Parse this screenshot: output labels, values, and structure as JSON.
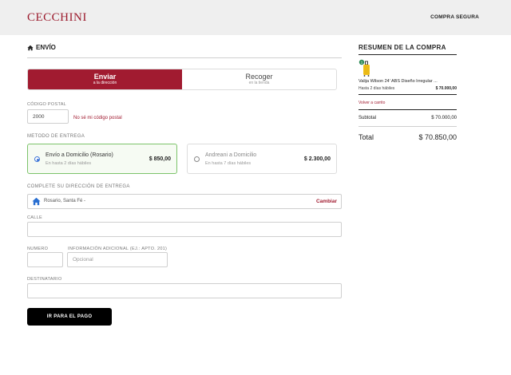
{
  "header": {
    "brand": "CECCHINI",
    "secure_label": "COMPRA SEGURA"
  },
  "shipping": {
    "section_title": "ENVÍO",
    "tabs": [
      {
        "label": "Enviar",
        "sublabel": "a la dirección",
        "active": true
      },
      {
        "label": "Recoger",
        "sublabel": "en la tienda",
        "active": false
      }
    ],
    "postal_code_label": "CÓDIGO POSTAL",
    "postal_code_value": "2000",
    "no_zip_link": "No sé mi código postal",
    "method_label": "METODO DE ENTREGA",
    "methods": [
      {
        "name": "Envío a Domicilio (Rosario)",
        "eta": "En hasta 2 días hábiles",
        "price": "$ 850,00",
        "selected": true
      },
      {
        "name": "Andreani a Domicilio",
        "eta": "En hasta 7 días hábiles",
        "price": "$ 2.300,00",
        "selected": false
      }
    ],
    "address_section_label": "COMPLETE SU DIRECCIÓN DE ENTREGA",
    "address_value": "Rosario, Santa Fé -",
    "change_link": "Cambiar",
    "street_label": "CALLE",
    "street_value": "",
    "number_label": "NUMERO",
    "number_value": "",
    "additional_label": "INFORMACIÓN ADICIONAL (EJ.: APTO. 201)",
    "additional_placeholder": "Opcional",
    "recipient_label": "DESTINATARIO",
    "recipient_value": "",
    "pay_button": "IR PARA EL PAGO"
  },
  "summary": {
    "title": "RESUMEN DE LA COMPRA",
    "product": {
      "quantity_badge": "1",
      "name": "Valija Wilson 24' ABS Diseño Irregular ...",
      "delivery": "Hasta 2 días hábiles",
      "price": "$ 70.000,00"
    },
    "back_link": "Volver a carrito",
    "subtotal_label": "Subtotal",
    "subtotal_value": "$ 70.000,00",
    "total_label": "Total",
    "total_value": "$ 70.850,00"
  },
  "colors": {
    "brand": "#a11b30",
    "selected_border": "#7cc36a",
    "radio_blue": "#3b74d6"
  }
}
